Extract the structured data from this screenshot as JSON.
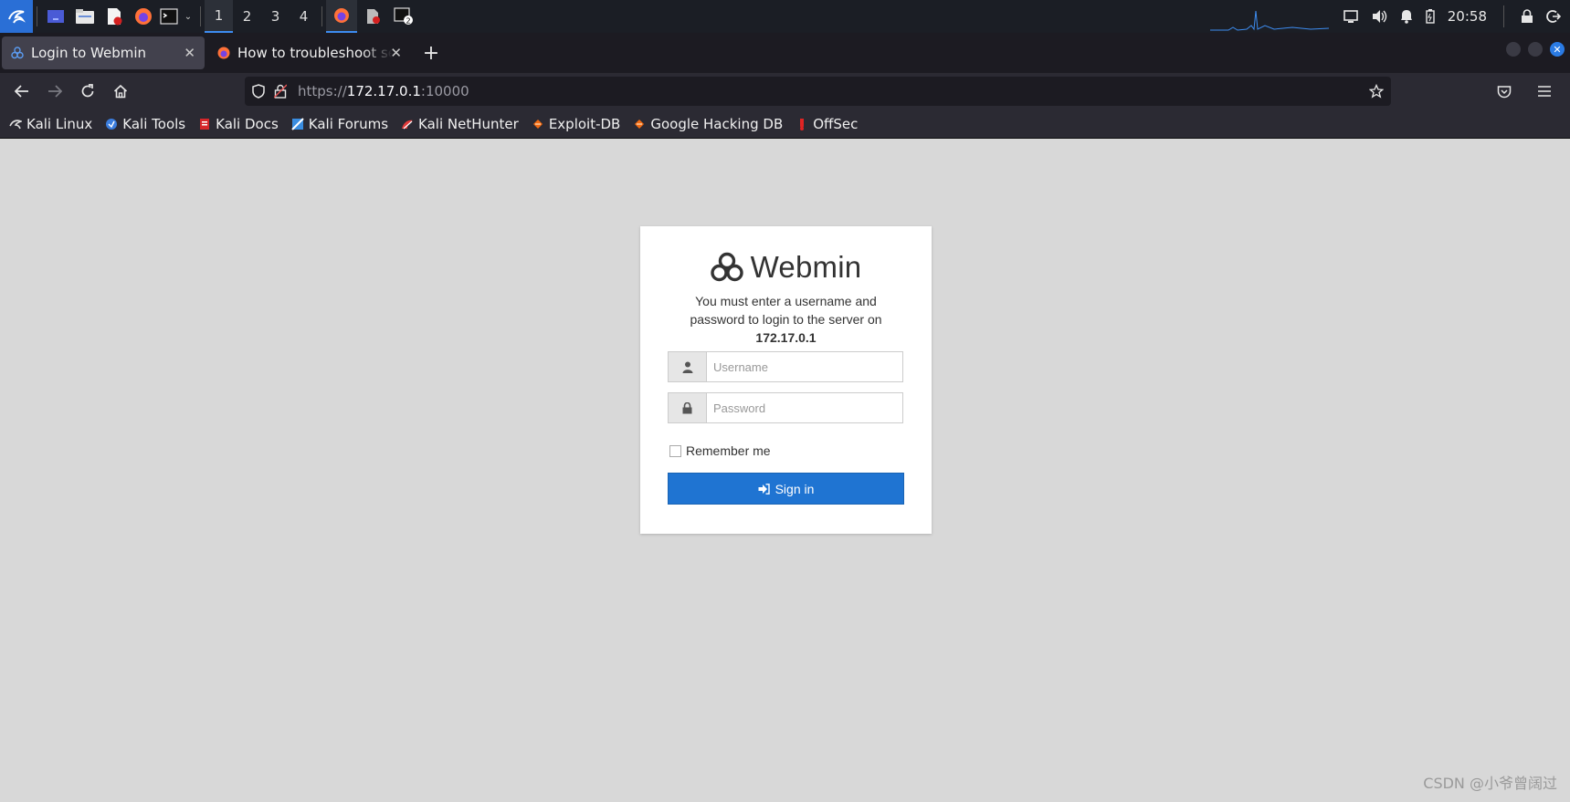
{
  "taskbar": {
    "workspaces": [
      "1",
      "2",
      "3",
      "4"
    ],
    "active_workspace": "1",
    "clock": "20:58"
  },
  "tabs": [
    {
      "label": "Login to Webmin",
      "active": true
    },
    {
      "label": "How to troubleshoot secu",
      "active": false
    }
  ],
  "urlbar": {
    "scheme": "https://",
    "host": "172.17.0.1",
    "port": ":10000"
  },
  "bookmarks": [
    {
      "label": "Kali Linux",
      "icon": "kali-dragon-icon"
    },
    {
      "label": "Kali Tools",
      "icon": "kali-tools-icon"
    },
    {
      "label": "Kali Docs",
      "icon": "kali-docs-icon"
    },
    {
      "label": "Kali Forums",
      "icon": "kali-forums-icon"
    },
    {
      "label": "Kali NetHunter",
      "icon": "nethunter-icon"
    },
    {
      "label": "Exploit-DB",
      "icon": "exploit-db-icon"
    },
    {
      "label": "Google Hacking DB",
      "icon": "ghdb-icon"
    },
    {
      "label": "OffSec",
      "icon": "offsec-icon"
    }
  ],
  "login": {
    "title": "Webmin",
    "message": "You must enter a username and password to login to the server on",
    "server": "172.17.0.1",
    "username_placeholder": "Username",
    "password_placeholder": "Password",
    "remember_label": "Remember me",
    "signin_label": "Sign in"
  },
  "watermark": "CSDN @小爷曾阔过",
  "colors": {
    "accent": "#1f74d2",
    "page_bg": "#d8d8d8",
    "taskbar_bg": "#1b1e25",
    "toolbar_bg": "#2b2a33"
  }
}
